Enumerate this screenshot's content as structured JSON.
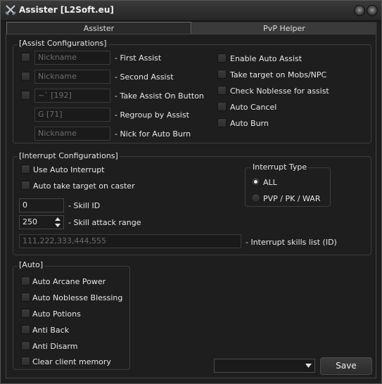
{
  "window": {
    "title": "Assister [L2Soft.eu]"
  },
  "tabs": [
    {
      "label": "Assister"
    },
    {
      "label": "PvP Helper"
    }
  ],
  "assist_config": {
    "title": "[Assist Configurations]",
    "rows": [
      {
        "value": "Nickname",
        "label": "- First Assist"
      },
      {
        "value": "Nickname",
        "label": "- Second Assist"
      },
      {
        "value": "~` [192]",
        "label": "- Take Assist On Button"
      },
      {
        "value": "G [71]",
        "label": "- Regroup by Assist"
      },
      {
        "value": "Nickname",
        "label": "- Nick for Auto Burn"
      }
    ],
    "options": [
      {
        "label": "Enable Auto Assist"
      },
      {
        "label": "Take target on Mobs/NPC"
      },
      {
        "label": "Check Noblesse for assist"
      },
      {
        "label": "Auto Cancel"
      },
      {
        "label": "Auto Burn"
      }
    ]
  },
  "interrupt_config": {
    "title": "[Interrupt Configurations]",
    "use_auto_interrupt": "Use Auto Interrupt",
    "auto_take_target": "Auto take target on caster",
    "skill_id_value": "0",
    "skill_id_label": "- Skill ID",
    "range_value": "250",
    "range_label": "- Skill attack range",
    "skills_list_placeholder": "111,222,333,444,555",
    "skills_list_label": "- Interrupt skills list (ID)",
    "interrupt_type": {
      "title": "Interrupt Type",
      "options": [
        {
          "label": "ALL",
          "selected": true
        },
        {
          "label": "PVP / PK / WAR",
          "selected": false
        }
      ]
    }
  },
  "auto": {
    "title": "[Auto]",
    "options": [
      {
        "label": "Auto Arcane Power"
      },
      {
        "label": "Auto Noblesse Blessing"
      },
      {
        "label": "Auto Potions"
      },
      {
        "label": "Anti Back"
      },
      {
        "label": "Anti Disarm"
      },
      {
        "label": "Clear client memory"
      }
    ]
  },
  "footer": {
    "profile_value": "",
    "save_label": "Save"
  }
}
